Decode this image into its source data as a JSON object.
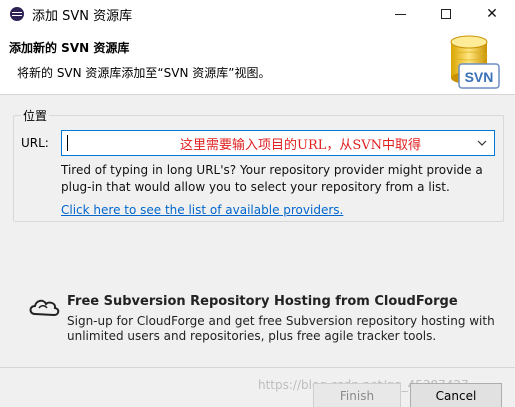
{
  "window": {
    "title": "添加 SVN 资源库"
  },
  "header": {
    "title": "添加新的 SVN 资源库",
    "description": "将新的 SVN 资源库添加至“SVN 资源库”视图。",
    "logo_text": "SVN"
  },
  "location_group": {
    "legend": "位置",
    "url_label": "URL:",
    "url_value": "",
    "url_annotation": "这里需要输入项目的URL，从SVN中取得",
    "help_text": "Tired of typing in long URL's?  Your repository provider might provide a plug-in that would allow you to select your repository from a list.",
    "providers_link": "Click here to see the list of available providers."
  },
  "cloudforge": {
    "title": "Free Subversion Repository Hosting from CloudForge",
    "description": "Sign-up for CloudForge and get free Subversion repository hosting with unlimited users and repositories, plus free agile tracker tools."
  },
  "buttons": {
    "finish": "Finish",
    "cancel": "Cancel"
  },
  "watermark": "https://blog.csdn.net/qq_45387427",
  "colors": {
    "accent": "#0078d7",
    "link": "#0066cc",
    "annotation": "#e02020"
  }
}
